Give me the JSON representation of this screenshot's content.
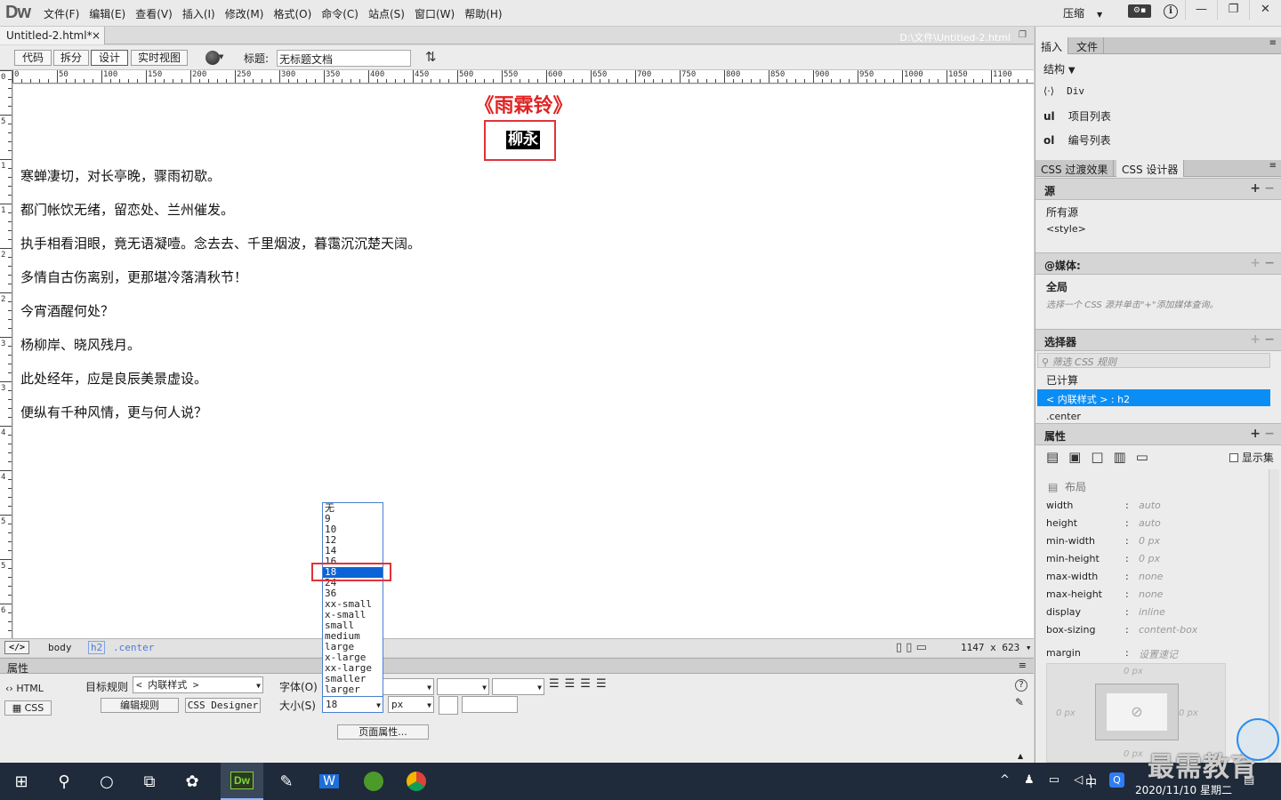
{
  "app": {
    "logo": "Dw",
    "menu": [
      "文件(F)",
      "编辑(E)",
      "查看(V)",
      "插入(I)",
      "修改(M)",
      "格式(O)",
      "命令(C)",
      "站点(S)",
      "窗口(W)",
      "帮助(H)"
    ],
    "workspace": "压缩",
    "window_controls": [
      "—",
      "❐",
      "✕"
    ]
  },
  "document": {
    "tab_name": "Untitled-2.html*",
    "path": "D:\\文件\\Untitled-2.html"
  },
  "toolbar": {
    "views": [
      "代码",
      "拆分",
      "设计",
      "实时视图"
    ],
    "active_view": "设计",
    "title_label": "标题:",
    "title_value": "无标题文档"
  },
  "ruler": {
    "top_labels": [
      "0",
      "50",
      "100",
      "150",
      "200",
      "250",
      "300",
      "350",
      "400",
      "450",
      "500",
      "550",
      "600",
      "650",
      "700",
      "750",
      "800",
      "850",
      "900",
      "950",
      "1000",
      "1050",
      "1100"
    ],
    "left_labels": [
      "0",
      "5",
      "1",
      "1",
      "2",
      "2",
      "3",
      "3",
      "4",
      "4",
      "5",
      "5",
      "6"
    ]
  },
  "content": {
    "title": "《雨霖铃》",
    "author": "柳永",
    "lines": [
      "寒蝉凄切，对长亭晚，骤雨初歇。",
      "都门帐饮无绪，留恋处、兰州催发。",
      "执手相看泪眼，竟无语凝噎。念去去、千里烟波，暮霭沉沉楚天阔。",
      "多情自古伤离别，更那堪冷落清秋节！",
      "今宵酒醒何处？",
      "杨柳岸、晓风残月。",
      "此处经年，应是良辰美景虚设。",
      "便纵有千种风情，更与何人说？"
    ]
  },
  "size_dropdown": {
    "options": [
      "无",
      "9",
      "10",
      "12",
      "14",
      "16",
      "18",
      "24",
      "36",
      "xx-small",
      "x-small",
      "small",
      "medium",
      "large",
      "x-large",
      "xx-large",
      "smaller",
      "larger"
    ],
    "selected": "18"
  },
  "statusbar": {
    "tag_icon": "</>",
    "tags": [
      "body",
      "h2",
      ".center"
    ],
    "dimensions": "1147 x 623"
  },
  "properties": {
    "title": "属性",
    "html_btn": "HTML",
    "css_btn": "CSS",
    "target_rule_label": "目标规则",
    "target_rule_value": "< 内联样式 >",
    "edit_rule_btn": "编辑规则",
    "css_designer_btn": "CSS Designer",
    "font_label": "字体(O)",
    "size_label": "大小(S)",
    "size_value": "18",
    "unit_value": "px",
    "page_props_btn": "页面属性..."
  },
  "right_panel": {
    "tabs_top": [
      "插入",
      "文件"
    ],
    "structure_label": "结构",
    "insert_items": [
      {
        "icon": "div-icon",
        "label": "Div"
      },
      {
        "icon": "ul",
        "label": "项目列表"
      },
      {
        "icon": "ol",
        "label": "编号列表"
      }
    ],
    "tabs_css": [
      "CSS 过渡效果",
      "CSS 设计器"
    ],
    "sources_head": "源",
    "sources": [
      "所有源",
      "<style>"
    ],
    "media_head": "@媒体:",
    "media_global": "全局",
    "media_hint": "选择一个 CSS 源并单击\"+\"添加媒体查询。",
    "selectors_head": "选择器",
    "selector_filter": "筛选 CSS 规则",
    "selectors": [
      "已计算",
      "< 内联样式 > : h2",
      ".center"
    ],
    "selected_selector": "< 内联样式 > : h2",
    "props_head": "属性",
    "show_set": "显示集",
    "layout_label": "布局",
    "layout_props": [
      {
        "k": "width",
        "v": "auto"
      },
      {
        "k": "height",
        "v": "auto"
      },
      {
        "k": "min-width",
        "v": "0 px"
      },
      {
        "k": "min-height",
        "v": "0 px"
      },
      {
        "k": "max-width",
        "v": "none"
      },
      {
        "k": "max-height",
        "v": "none"
      },
      {
        "k": "display",
        "v": "inline"
      },
      {
        "k": "box-sizing",
        "v": "content-box"
      }
    ],
    "margin_label": "margin",
    "margin_value": "设置速记",
    "box_values": {
      "top": "0 px",
      "left": "0 px",
      "right": "0 px",
      "bottom": "0 px"
    }
  },
  "taskbar": {
    "date": "2020/11/10 星期二",
    "ime": "中",
    "watermark": "最需教育"
  }
}
